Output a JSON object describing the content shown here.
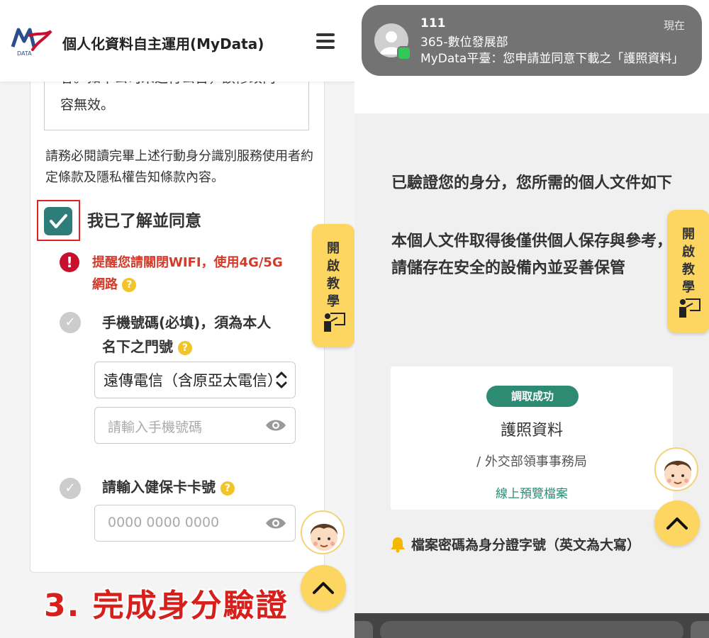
{
  "left": {
    "header": {
      "title": "個人化資料自主運用(MyData)",
      "logo_text": "DATA"
    },
    "terms": {
      "line1": "容。如本公司未進行公告，該修改內",
      "line2": "容無效。"
    },
    "notice": "請務必閱讀完畢上述行動身分識別服務使用者約定條款及隱私權告知條款內容。",
    "agree_label": "我已了解並同意",
    "warning": {
      "line1": "提醒您請關閉WIFI，使用4G/5G",
      "line2": "網路",
      "help": "?"
    },
    "phone_step": {
      "line1": "手機號碼(必填)，須為本人",
      "line2": "名下之門號",
      "help": "?"
    },
    "carrier_select": {
      "value": "遠傳電信（含原亞太電信）"
    },
    "phone_input": {
      "placeholder": "請輸入手機號碼"
    },
    "nhi_step": {
      "label": "請輸入健保卡卡號",
      "help": "?"
    },
    "nhi_input": {
      "placeholder": "0000 0000 0000"
    },
    "tutorial_label": "開啟教學",
    "step_caption": "3. 完成身分驗證"
  },
  "right": {
    "notification": {
      "line1": "111",
      "line2": "365-數位發展部",
      "line3": "MyData平臺：您申請並同意下載之「護照資料」",
      "time": "現在"
    },
    "heading": "已驗證您的身分，您所需的個人文件如下",
    "subtext": "本個人文件取得後僅供個人保存與參考，請儲存在安全的設備內並妥善保管",
    "document": {
      "badge": "調取成功",
      "title": "護照資料",
      "org": "/ 外交部領事事務局",
      "preview_link": "線上預覽檔案"
    },
    "password_note": "檔案密碼為身分證字號（英文為大寫）",
    "tutorial_label": "開啟教學"
  },
  "colors": {
    "teal": "#2e7d7a",
    "warning_red": "#d43a2a",
    "accent_yellow": "#fdd561",
    "caption_red": "#d7201c",
    "success_green": "#2e8b73"
  }
}
